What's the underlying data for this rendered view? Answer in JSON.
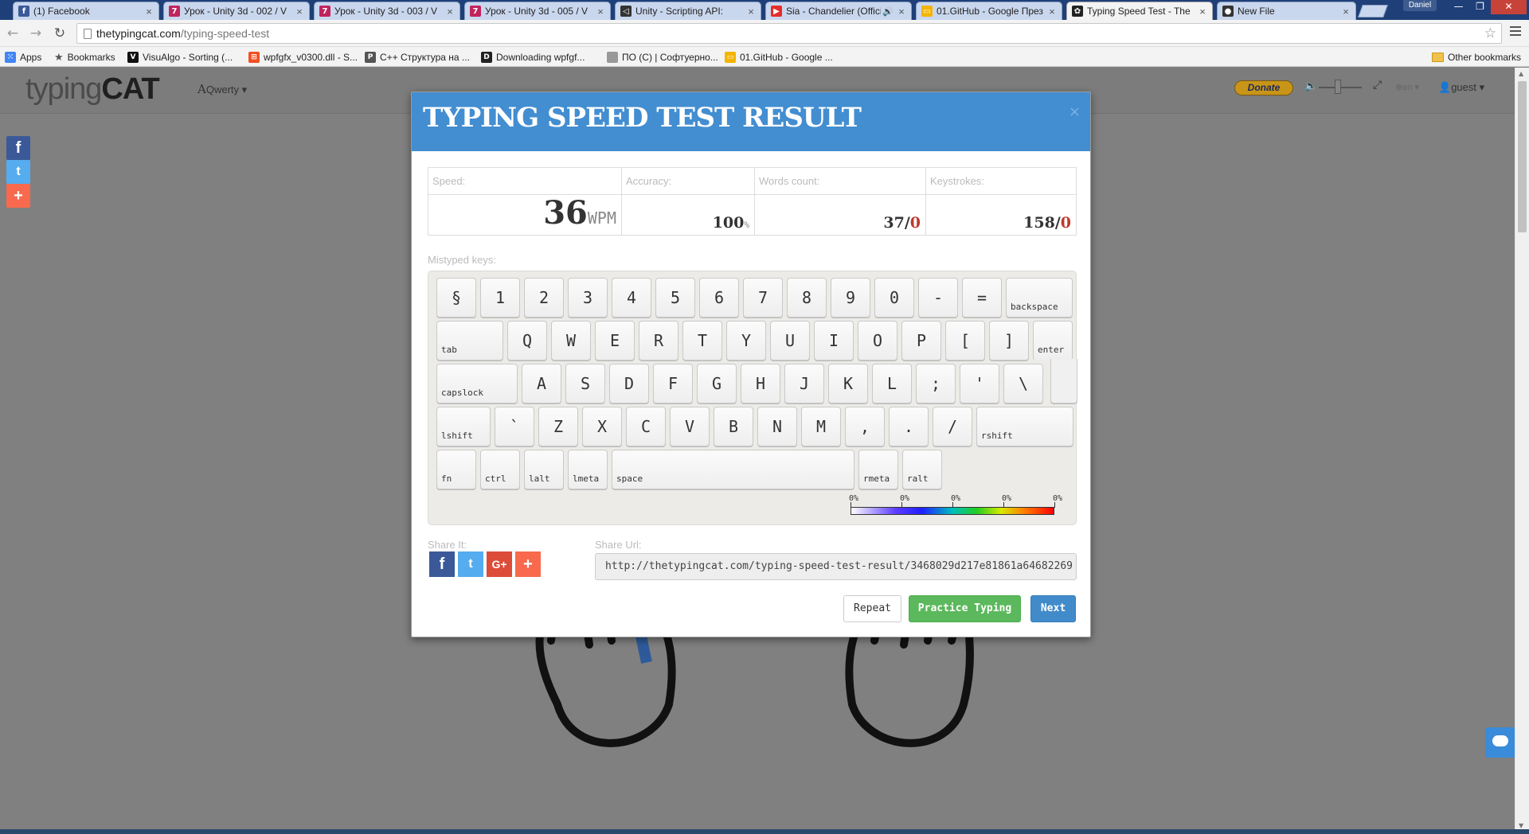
{
  "browser": {
    "tabs": [
      {
        "title": "(1) Facebook",
        "favicon": "facebook-icon",
        "color": "#3b5998",
        "glyph": "f"
      },
      {
        "title": "Урок - Unity 3d - 002 / V",
        "favicon": "unity-lesson-icon",
        "color": "#c0245c",
        "glyph": "7"
      },
      {
        "title": "Урок - Unity 3d - 003 / V",
        "favicon": "unity-lesson-icon",
        "color": "#c0245c",
        "glyph": "7"
      },
      {
        "title": "Урок - Unity 3d - 005 / V",
        "favicon": "unity-lesson-icon",
        "color": "#c0245c",
        "glyph": "7"
      },
      {
        "title": "Unity - Scripting API:",
        "favicon": "unity-icon",
        "color": "#333333",
        "glyph": "◁"
      },
      {
        "title": "Sia - Chandelier (Offici",
        "favicon": "youtube-icon",
        "color": "#e52d27",
        "glyph": "▶"
      },
      {
        "title": "01.GitHub - Google През",
        "favicon": "google-slides-icon",
        "color": "#f4b400",
        "glyph": "▭"
      },
      {
        "title": "Typing Speed Test - The",
        "favicon": "paw-icon",
        "color": "#222222",
        "glyph": "✿"
      },
      {
        "title": "New File",
        "favicon": "github-icon",
        "color": "#333333",
        "glyph": "●"
      }
    ],
    "profile": "Daniel",
    "url_host": "thetypingcat.com",
    "url_path": "/typing-speed-test",
    "bookmarks": [
      {
        "label": "Apps",
        "icon": "apps-icon"
      },
      {
        "label": "Bookmarks",
        "icon": "star-icon"
      },
      {
        "label": "VisuAlgo - Sorting (...",
        "icon": "visualgo-icon"
      },
      {
        "label": "wpfgfx_v0300.dll - S...",
        "icon": "windows-icon"
      },
      {
        "label": "C++ Структура на ...",
        "icon": "p-icon"
      },
      {
        "label": "Downloading wpfgf...",
        "icon": "dll-icon"
      },
      {
        "label": "ПО (С) | Софтуерно...",
        "icon": "page-icon"
      },
      {
        "label": "01.GitHub - Google ...",
        "icon": "google-slides-icon"
      }
    ],
    "other_bookmarks": "Other bookmarks"
  },
  "site": {
    "logo_light": "typing",
    "logo_bold": "CAT",
    "layout": "Qwerty",
    "donate": "Donate",
    "language": "en",
    "user": "guest",
    "feedback": "feedback"
  },
  "modal": {
    "title": "TYPING SPEED TEST RESULT",
    "close": "×",
    "stats": {
      "speed_label": "Speed:",
      "speed_value": "36",
      "speed_unit": "WPM",
      "accuracy_label": "Accuracy:",
      "accuracy_value": "100",
      "accuracy_unit": "%",
      "words_label": "Words count:",
      "words_value": "37/",
      "words_errors": "0",
      "keystrokes_label": "Keystrokes:",
      "keystrokes_value": "158/",
      "keystrokes_errors": "0"
    },
    "mistyped_label": "Mistyped keys:",
    "keyboard": {
      "row1": [
        "§",
        "1",
        "2",
        "3",
        "4",
        "5",
        "6",
        "7",
        "8",
        "9",
        "0",
        "-",
        "="
      ],
      "backspace": "backspace",
      "tab": "tab",
      "row2": [
        "Q",
        "W",
        "E",
        "R",
        "T",
        "Y",
        "U",
        "I",
        "O",
        "P",
        "[",
        "]"
      ],
      "enter": "enter",
      "capslock": "capslock",
      "row3": [
        "A",
        "S",
        "D",
        "F",
        "G",
        "H",
        "J",
        "K",
        "L",
        ";",
        "'",
        "\\"
      ],
      "lshift": "lshift",
      "row4": [
        "`",
        "Z",
        "X",
        "C",
        "V",
        "B",
        "N",
        "M",
        ",",
        ".",
        "/"
      ],
      "rshift": "rshift",
      "fn": "fn",
      "ctrl": "ctrl",
      "lalt": "lalt",
      "lmeta": "lmeta",
      "space": "space",
      "rmeta": "rmeta",
      "ralt": "ralt"
    },
    "legend_ticks": [
      "0%",
      "0%",
      "0%",
      "0%",
      "0%"
    ],
    "share_label": "Share It:",
    "share_url_label": "Share Url:",
    "share_url": "http://thetypingcat.com/typing-speed-test-result/3468029d217e81861a64682269",
    "repeat": "Repeat",
    "practice": "Practice Typing",
    "next": "Next"
  },
  "colors": {
    "modal_header": "#438ed1",
    "error": "#c0392b",
    "practice_button": "#5cb85c",
    "next_button": "#428bca",
    "facebook": "#3b5998",
    "twitter": "#55acee",
    "google_plus": "#dd4b39",
    "addthis": "#f8694d"
  }
}
